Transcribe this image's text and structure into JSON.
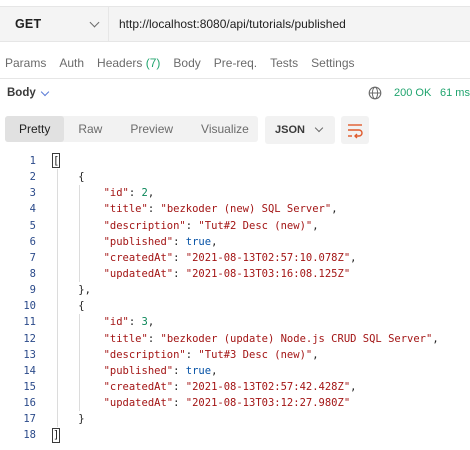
{
  "request": {
    "method": "GET",
    "url": "http://localhost:8080/api/tutorials/published"
  },
  "request_tabs": [
    {
      "label": "Params"
    },
    {
      "label": "Auth"
    },
    {
      "label": "Headers",
      "count": "(7)"
    },
    {
      "label": "Body"
    },
    {
      "label": "Pre-req."
    },
    {
      "label": "Tests"
    },
    {
      "label": "Settings"
    }
  ],
  "response": {
    "section_label": "Body",
    "status": "200 OK",
    "time": "61 ms",
    "view_tabs": [
      "Pretty",
      "Raw",
      "Preview",
      "Visualize"
    ],
    "active_view": "Pretty",
    "format": "JSON"
  },
  "colors": {
    "status_green": "#20a46e",
    "string_red": "#a31515",
    "number_green": "#098658",
    "bool_blue": "#0451a5"
  },
  "icons": [
    "chevron-down-icon",
    "globe-icon",
    "wrap-lines-icon"
  ],
  "code": {
    "line_numbers": [
      "1",
      "2",
      "3",
      "4",
      "5",
      "6",
      "7",
      "8",
      "9",
      "10",
      "11",
      "12",
      "13",
      "14",
      "15",
      "16",
      "17",
      "18"
    ],
    "tutorials": [
      {
        "id": "2",
        "title": "\"bezkoder (new) SQL Server\"",
        "description": "\"Tut#2 Desc (new)\"",
        "published": "true",
        "createdAt": "\"2021-08-13T02:57:10.078Z\"",
        "updatedAt": "\"2021-08-13T03:16:08.125Z\""
      },
      {
        "id": "3",
        "title": "\"bezkoder (update) Node.js CRUD SQL Server\"",
        "description": "\"Tut#3 Desc (new)\"",
        "published": "true",
        "createdAt": "\"2021-08-13T02:57:42.428Z\"",
        "updatedAt": "\"2021-08-13T03:12:27.980Z\""
      }
    ],
    "keys": {
      "id": "\"id\"",
      "title": "\"title\"",
      "description": "\"description\"",
      "published": "\"published\"",
      "createdAt": "\"createdAt\"",
      "updatedAt": "\"updatedAt\""
    }
  }
}
